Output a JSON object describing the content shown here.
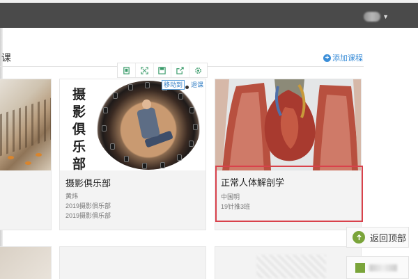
{
  "section": {
    "title": "课",
    "add_course": "添加课程"
  },
  "toolbar": {
    "icons": [
      "copy-icon",
      "fullscreen-icon",
      "save-icon",
      "share-icon",
      "settings-icon"
    ],
    "move_label": "移动到",
    "quit_label": "退课"
  },
  "cards": [
    {
      "name": "",
      "teacher": "",
      "class": ""
    },
    {
      "cover_text": [
        "摄",
        "影",
        "俱",
        "乐",
        "部"
      ],
      "name": "摄影俱乐部",
      "teacher": "黄炜",
      "class_1": "2019摄影俱乐部",
      "class_2": "2019摄影俱乐部"
    },
    {
      "name": "正常人体解剖学",
      "teacher": "中国明",
      "class": "19针推3班"
    }
  ],
  "side": {
    "back_top": "返回顶部"
  },
  "colors": {
    "header": "#4a4a4a",
    "accent": "#3b8ed8",
    "highlight": "#d9414b",
    "green": "#7aa43a"
  }
}
